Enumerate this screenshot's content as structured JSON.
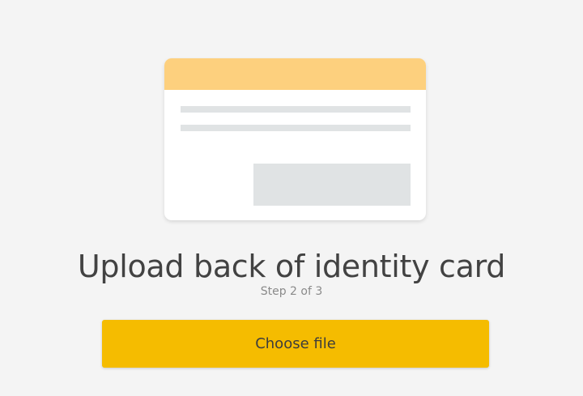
{
  "illustration": {
    "header_color": "#fdd07e",
    "placeholder_color": "#e0e3e4",
    "icon": "identity-card-back-illustration"
  },
  "heading": {
    "title": "Upload back of identity card",
    "step": "Step 2 of 3"
  },
  "actions": {
    "choose_file_label": "Choose file",
    "button_color": "#f5bc00"
  }
}
